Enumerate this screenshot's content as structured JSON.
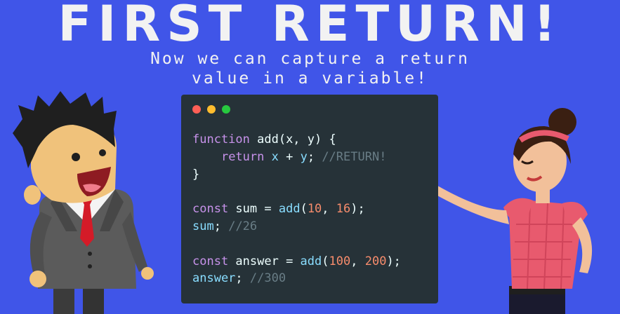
{
  "header": {
    "title": "FIRST RETURN!",
    "subtitle_line1": "Now we can capture a return",
    "subtitle_line2": "value in a variable!"
  },
  "editor": {
    "window_dots": [
      "#ff5f56",
      "#ffbd2e",
      "#27c93f"
    ],
    "code": {
      "l1_kw": "function",
      "l1_rest": " add(x, y) {",
      "l2_indent": "    ",
      "l2_kw": "return",
      "l2_x": " x",
      "l2_op": " + ",
      "l2_y": "y",
      "l2_semi": "; ",
      "l2_comment": "//RETURN!",
      "l3": "}",
      "l5_kw": "const",
      "l5_name": " sum = ",
      "l5_fn": "add",
      "l5_open": "(",
      "l5_a": "10",
      "l5_comma": ", ",
      "l5_b": "16",
      "l5_close": ");",
      "l6_var": "sum",
      "l6_semi": "; ",
      "l6_comment": "//26",
      "l8_kw": "const",
      "l8_name": " answer = ",
      "l8_fn": "add",
      "l8_open": "(",
      "l8_a": "100",
      "l8_comma": ", ",
      "l8_b": "200",
      "l8_close": ");",
      "l9_var": "answer",
      "l9_semi": "; ",
      "l9_comment": "//300"
    }
  },
  "colors": {
    "background": "#4055e8",
    "editor_bg": "#263238",
    "keyword": "#c792ea",
    "number": "#f78c6c",
    "comment": "#697d86"
  },
  "illustrations": [
    "businessman-character",
    "woman-presenter-character"
  ]
}
